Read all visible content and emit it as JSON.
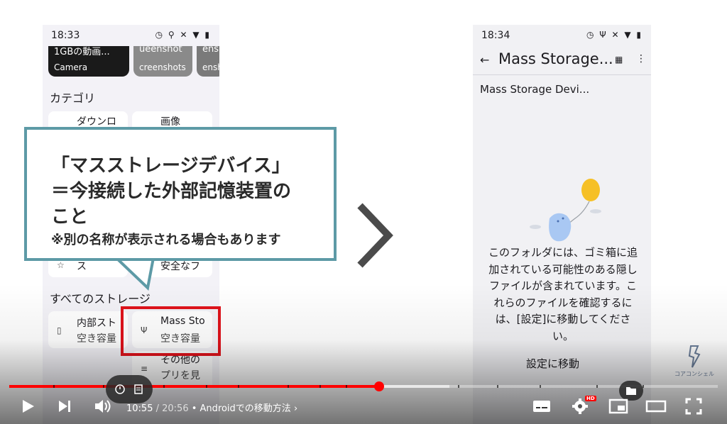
{
  "left_phone": {
    "status": {
      "time": "18:33",
      "icons": "◷ ⚲      ✕ ▼ ▮"
    },
    "albums": [
      {
        "top": "1GBの動画...",
        "label": "Camera"
      },
      {
        "top": "ueenshot",
        "label": "creenshots"
      },
      {
        "top": "ens",
        "label": "enshots"
      }
    ],
    "categories_title": "カテゴリ",
    "category_cards": [
      {
        "icon": "↓",
        "line1": "ダウンロ"
      },
      {
        "icon": "▢",
        "line1": "画像"
      },
      {
        "icon": "☆",
        "line1": "ス"
      },
      {
        "icon": "",
        "line1": "安全なフ"
      }
    ],
    "storage_title": "すべてのストレージ",
    "storage_cards": [
      {
        "icon": "▯",
        "line1": "内部スト",
        "line2": "空き容量"
      },
      {
        "icon": "Ψ",
        "line1": "Mass Sto",
        "line2": "空き容量"
      },
      {
        "icon": "≡",
        "line1": "その他の",
        "line2": "プリを見"
      }
    ]
  },
  "callout": {
    "line1": "「マスストレージデバイス」",
    "line2": "＝今接続した外部記憶装置の",
    "line3": "こと",
    "note": "※別の名称が表示される場合もあります",
    "border_color": "#5d9aa6"
  },
  "right_phone": {
    "status": {
      "time": "18:34",
      "icons": "◷ Ψ      ✕ ▼ ▮"
    },
    "appbar": {
      "back": "←",
      "title": "Mass Storage...",
      "grid": "▦",
      "more": "⋮"
    },
    "breadcrumb": "Mass Storage Devi...",
    "empty_message": "このフォルダには、ゴミ箱に追加されている可能性のある隠しファイルが含まれています。これらのファイルを確認するには、[設定]に移動してください。",
    "action": "設定に移動"
  },
  "watermark": {
    "text": "コアコンシェル"
  },
  "player": {
    "current_time": "10:55",
    "separator": " / ",
    "duration": "20:56",
    "chapter_prefix": " • ",
    "chapter": "Androidでの移動方法",
    "chapter_arrow": "›",
    "progress": 0.524,
    "buffered": 0.62,
    "hd_badge": "HD",
    "accent": "#ff0000"
  }
}
